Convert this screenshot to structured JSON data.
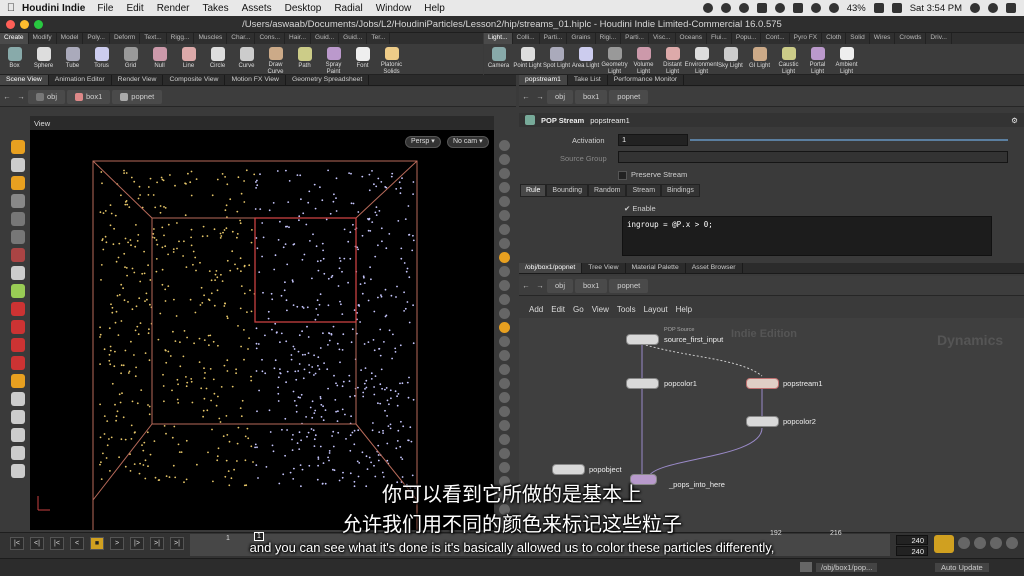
{
  "menubar": {
    "app_name": "Houdini Indie",
    "menus": [
      "File",
      "Edit",
      "Render",
      "Takes",
      "Assets",
      "Desktop",
      "Radial",
      "Window",
      "Help"
    ],
    "battery": "43%",
    "clock": "Sat 3:54 PM"
  },
  "window": {
    "title": "/Users/aswaab/Documents/Jobs/L2/HoudiniParticles/Lesson2/hip/streams_01.hiplc - Houdini Indie Limited-Commercial 16.0.575"
  },
  "shelf_left": {
    "tabs": [
      "Create",
      "Modify",
      "Model",
      "Poly...",
      "Deform",
      "Text...",
      "Rigg...",
      "Muscles",
      "Char...",
      "Cons...",
      "Hair...",
      "Guid...",
      "Guid...",
      "Ter..."
    ],
    "tools": [
      "Box",
      "Sphere",
      "Tube",
      "Torus",
      "Grid",
      "Null",
      "Line",
      "Circle",
      "Curve",
      "Draw Curve",
      "Path",
      "Spray Paint",
      "Font",
      "Platonic Solids"
    ]
  },
  "shelf_right": {
    "tabs": [
      "Light...",
      "Colli...",
      "Parti...",
      "Grains",
      "Rigi...",
      "Parti...",
      "Visc...",
      "Oceans",
      "Flui...",
      "Popu...",
      "Cont...",
      "Pyro FX",
      "Cloth",
      "Solid",
      "Wires",
      "Crowds",
      "Driv..."
    ],
    "tools": [
      "Camera",
      "Point Light",
      "Spot Light",
      "Area Light",
      "Geometry Light",
      "Volume Light",
      "Distant Light",
      "Environment Light",
      "Sky Light",
      "GI Light",
      "Caustic Light",
      "Portal Light",
      "Ambient Light"
    ]
  },
  "left_pane": {
    "tabs": [
      "Scene View",
      "Animation Editor",
      "Render View",
      "Composite View",
      "Motion FX View",
      "Geometry Spreadsheet"
    ],
    "path": [
      "obj",
      "box1",
      "popnet"
    ],
    "view_label": "View",
    "persp": "Persp",
    "cam": "No cam"
  },
  "param_pane": {
    "tabs": [
      "popstream1",
      "Take List",
      "Performance Monitor"
    ],
    "path": [
      "obj",
      "box1",
      "popnet"
    ],
    "node_type": "POP Stream",
    "node_name": "popstream1",
    "activation_label": "Activation",
    "activation_value": "1",
    "source_group_label": "Source Group",
    "preserve_stream": "Preserve Stream",
    "subtabs": [
      "Rule",
      "Bounding",
      "Random",
      "Stream",
      "Bindings"
    ],
    "enable": "Enable",
    "code": "ingroup = @P.x > 0;"
  },
  "network_pane": {
    "tabs": [
      "/obj/box1/popnet",
      "Tree View",
      "Material Palette",
      "Asset Browser"
    ],
    "path": [
      "obj",
      "box1",
      "popnet"
    ],
    "menu": [
      "Add",
      "Edit",
      "Go",
      "View",
      "Tools",
      "Layout",
      "Help"
    ],
    "watermark_edition": "Indie Edition",
    "watermark_context": "Dynamics",
    "nodes": {
      "source_type": "POP Source",
      "source": "source_first_input",
      "color1": "popcolor1",
      "stream": "popstream1",
      "color2": "popcolor2",
      "object": "popobject",
      "output": "_pops_into_here"
    }
  },
  "timeline": {
    "current_frame": "1",
    "start": "1",
    "tick_192": "192",
    "tick_216": "216",
    "end1": "240",
    "end2": "240"
  },
  "statusbar": {
    "path": "/obj/box1/pop...",
    "update": "Auto Update"
  },
  "subtitles": {
    "cn_line1": "你可以看到它所做的是基本上",
    "cn_line2": "允许我们用不同的颜色来标记这些粒子",
    "en_line": "and you can see what it's done is it's basically allowed us to color these particles differently,"
  },
  "colors": {
    "particle_yellow": "#e8c86a",
    "particle_blue": "#c8c8ff",
    "box_red": "#c84040",
    "bbox_line": "#b86a5a"
  }
}
